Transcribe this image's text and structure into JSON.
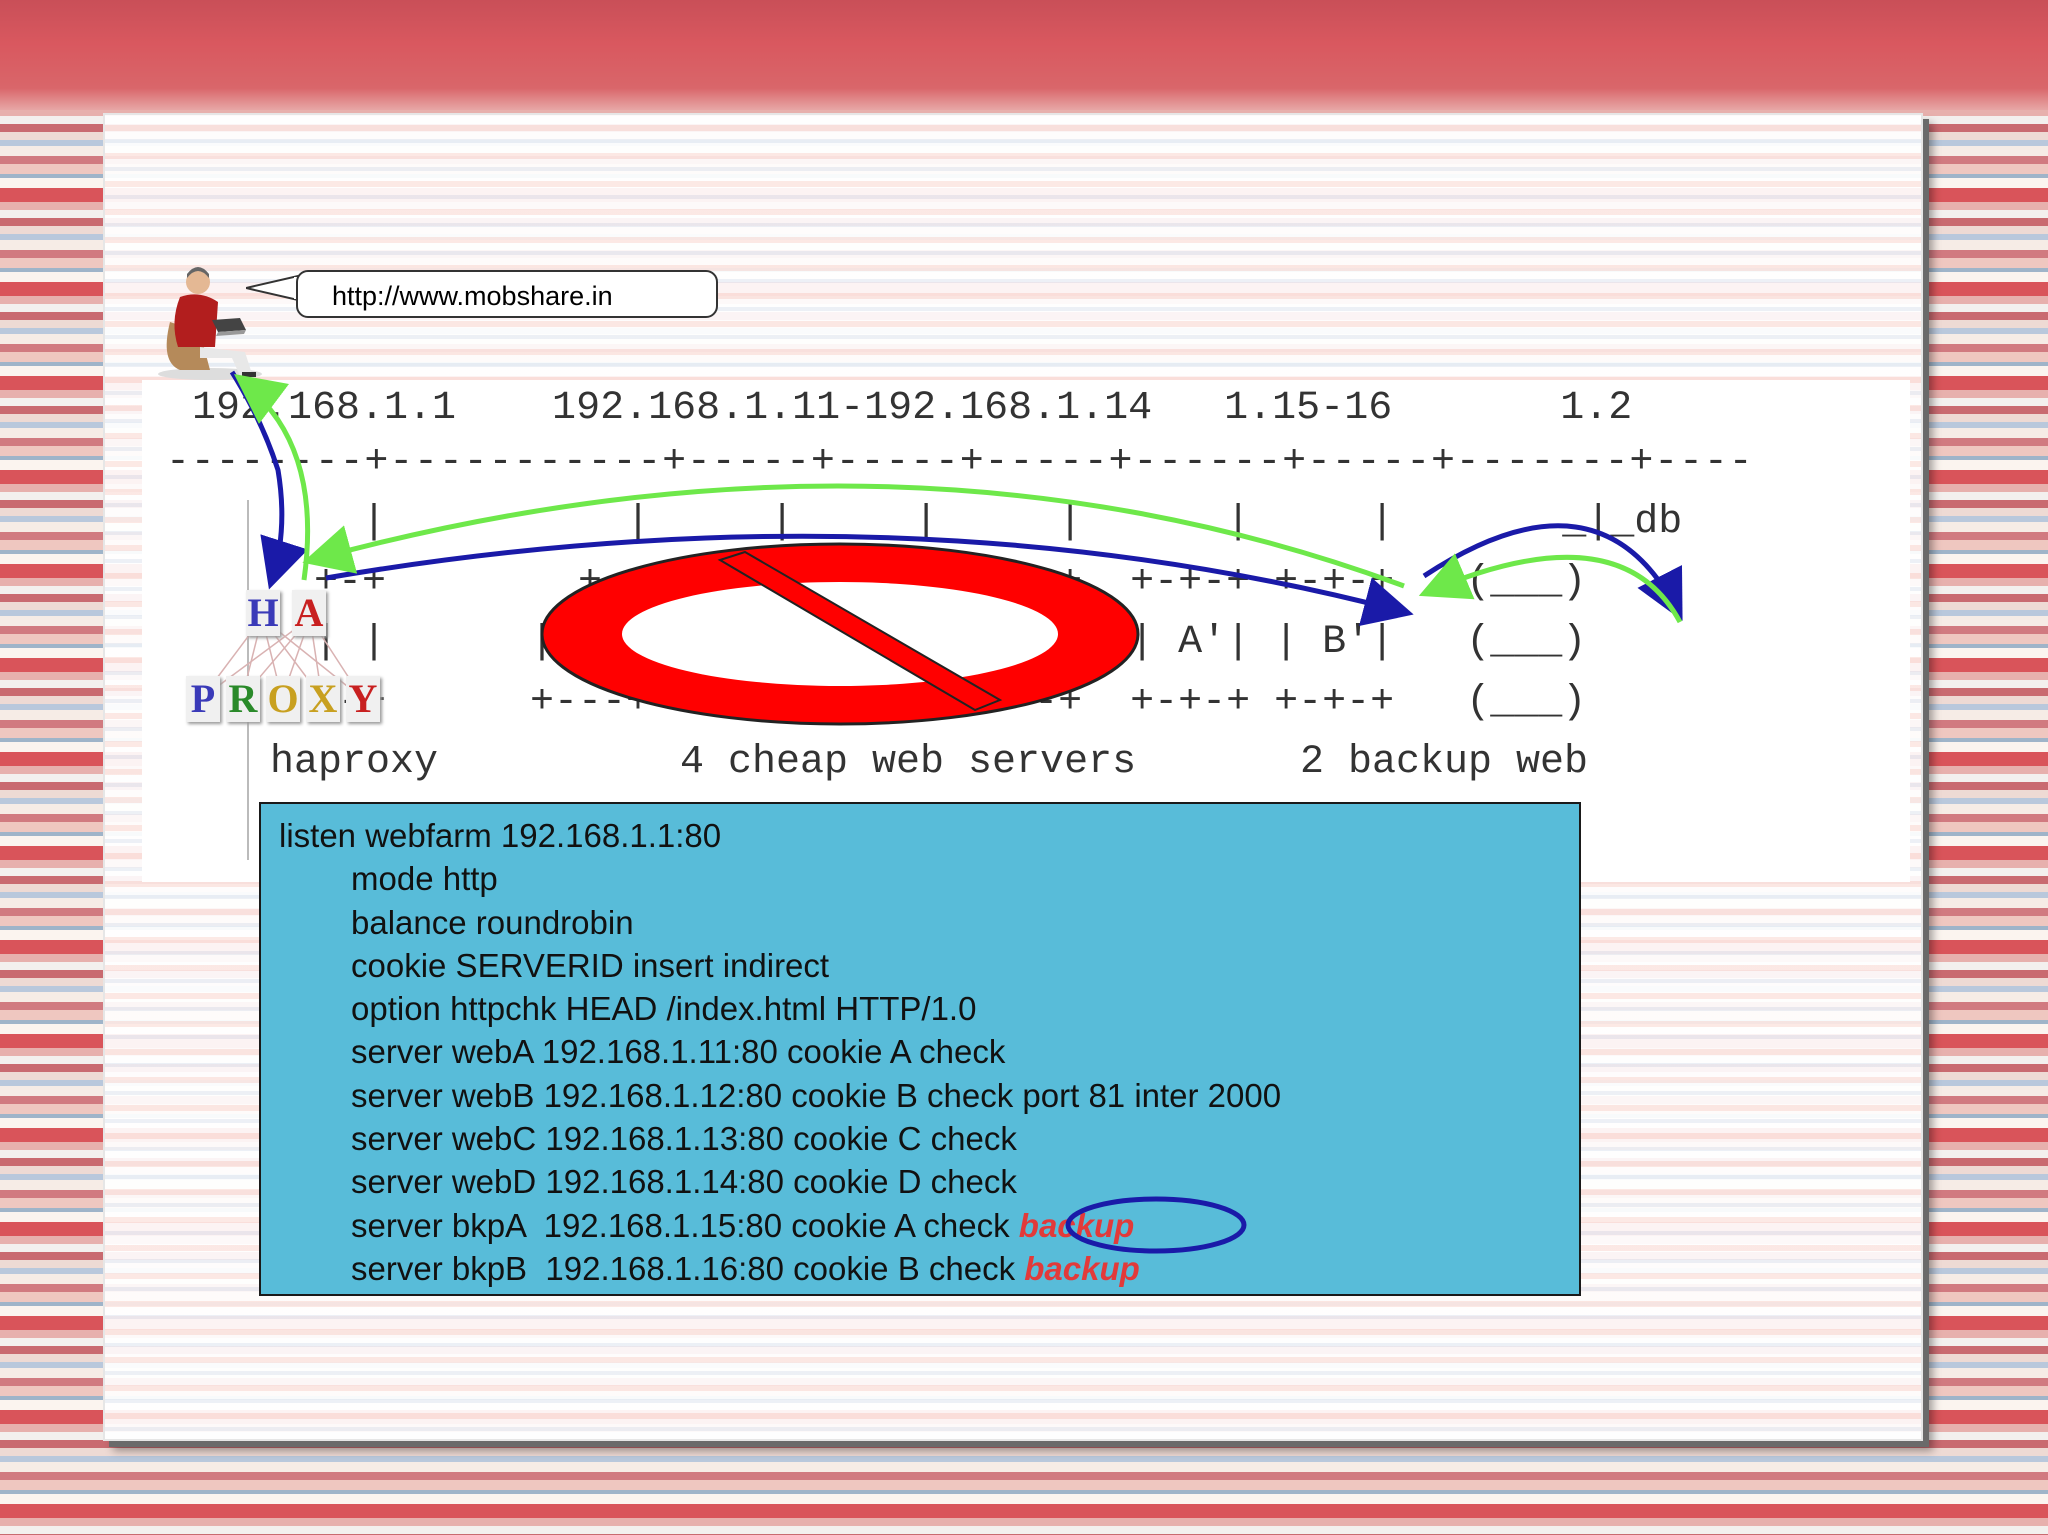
{
  "bubble": {
    "url": "http://www.mobshare.in"
  },
  "diagram": {
    "ip_row": "192.168.1.1    192.168.1.11-192.168.1.14   1.15-16       1.2",
    "network_line": "--------+-----------+-----+-----+-----+------+-----+-------+----",
    "row_pipes": "    |          |     |     |     |      |     |       _|_db",
    "row_box_top": "  +-+        +-+-+ +-+ +-+-+ +-+-+  +-+-+ +-+-+   (___)",
    "row_box_mid": "  | |      | A | | B | | C | | D |  | A'| | B'|   (___)",
    "row_box_bot": "  +-+      +---+ +---+ +---+ +---+  +-+-+ +-+-+   (___)",
    "label_haproxy": "haproxy",
    "label_servers": "4 cheap web servers",
    "label_backup": "2 backup web",
    "logo_top": [
      "H",
      "A"
    ],
    "logo_bottom": [
      "P",
      "R",
      "O",
      "X",
      "Y"
    ]
  },
  "config": {
    "lines": [
      "listen webfarm 192.168.1.1:80",
      "mode http",
      "balance roundrobin",
      "cookie SERVERID insert indirect",
      "option httpchk HEAD /index.html HTTP/1.0",
      "server webA 192.168.1.11:80 cookie A check",
      "server webB 192.168.1.12:80 cookie B check port 81 inter 2000",
      "server webC 192.168.1.13:80 cookie C check",
      "server webD 192.168.1.14:80 cookie D check",
      "server bkpA  192.168.1.15:80 cookie A check",
      "server bkpB  192.168.1.16:80 cookie B check"
    ],
    "backup_word": "backup"
  },
  "colors": {
    "config_bg": "#58bcd9",
    "arrow_blue": "#1a1aa8",
    "arrow_green": "#6ee84a",
    "no_sign_red": "#ff0000",
    "backup_red": "#e23a3a"
  }
}
